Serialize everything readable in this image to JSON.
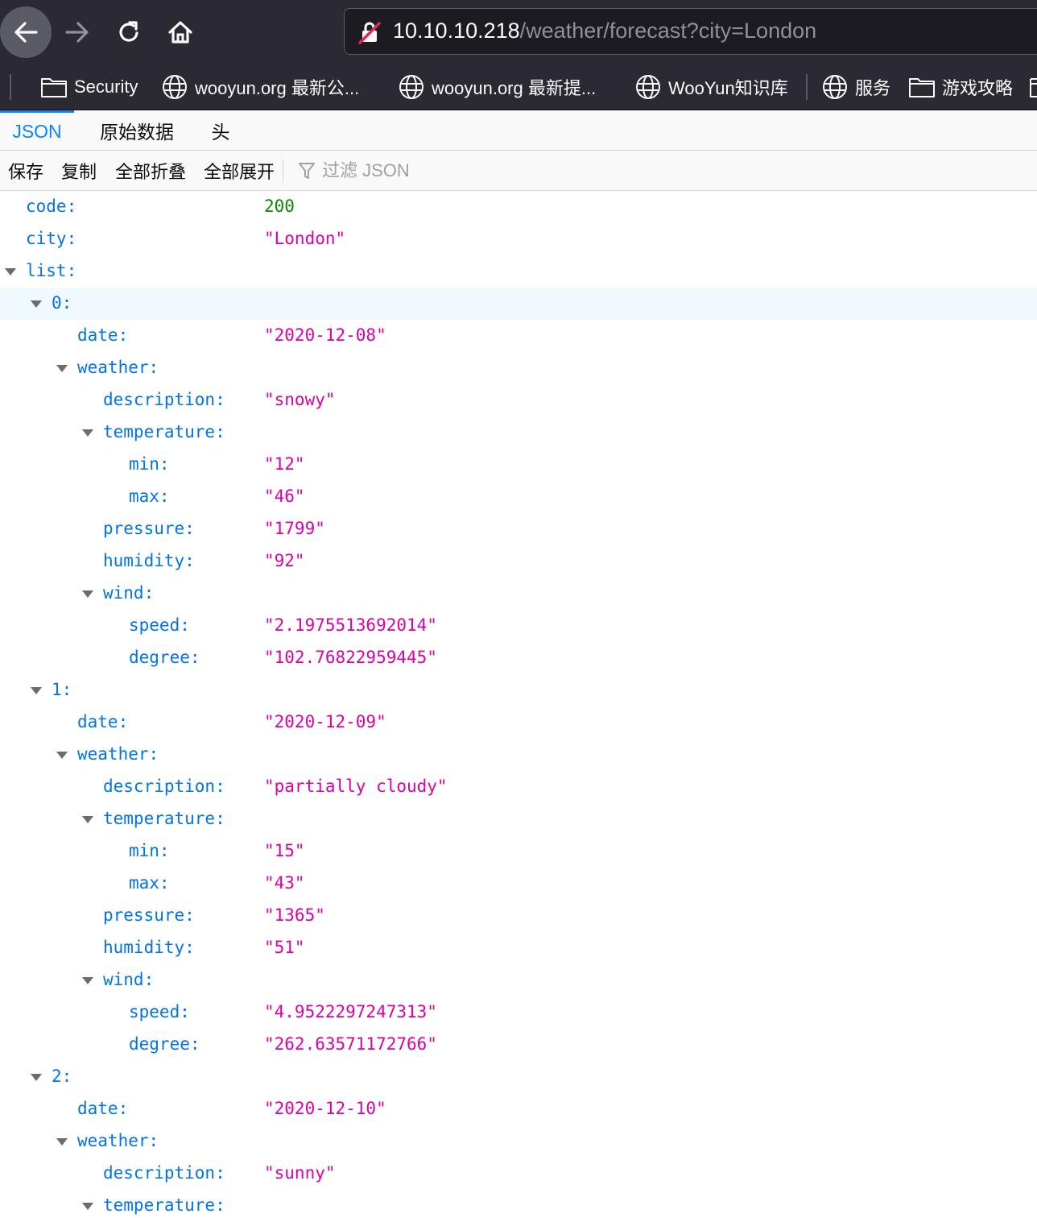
{
  "url": {
    "host": "10.10.10.218",
    "path": "/weather/forecast?city=London"
  },
  "bookmarks": [
    {
      "label": "Security",
      "icon": "folder-icon"
    },
    {
      "label": "wooyun.org 最新公...",
      "icon": "globe-icon"
    },
    {
      "label": "wooyun.org 最新提...",
      "icon": "globe-icon"
    },
    {
      "label": "WooYun知识库",
      "icon": "globe-icon"
    },
    {
      "label": "服务",
      "icon": "globe-icon"
    },
    {
      "label": "游戏攻略",
      "icon": "folder-icon"
    }
  ],
  "tabs": {
    "json": "JSON",
    "raw": "原始数据",
    "headers": "头"
  },
  "actions": {
    "save": "保存",
    "copy": "复制",
    "collapse_all": "全部折叠",
    "expand_all": "全部展开",
    "filter_placeholder": "过滤 JSON"
  },
  "tree": [
    {
      "depth": 0,
      "key": "code:",
      "value": "200",
      "type": "num"
    },
    {
      "depth": 0,
      "key": "city:",
      "value": "\"London\"",
      "type": "str"
    },
    {
      "depth": 0,
      "key": "list:",
      "expandable": true
    },
    {
      "depth": 1,
      "key": "0:",
      "expandable": true,
      "selected": true
    },
    {
      "depth": 2,
      "key": "date:",
      "value": "\"2020-12-08\"",
      "type": "str"
    },
    {
      "depth": 2,
      "key": "weather:",
      "expandable": true
    },
    {
      "depth": 3,
      "key": "description:",
      "value": "\"snowy\"",
      "type": "str"
    },
    {
      "depth": 3,
      "key": "temperature:",
      "expandable": true
    },
    {
      "depth": 4,
      "key": "min:",
      "value": "\"12\"",
      "type": "str"
    },
    {
      "depth": 4,
      "key": "max:",
      "value": "\"46\"",
      "type": "str"
    },
    {
      "depth": 3,
      "key": "pressure:",
      "value": "\"1799\"",
      "type": "str"
    },
    {
      "depth": 3,
      "key": "humidity:",
      "value": "\"92\"",
      "type": "str"
    },
    {
      "depth": 3,
      "key": "wind:",
      "expandable": true
    },
    {
      "depth": 4,
      "key": "speed:",
      "value": "\"2.1975513692014\"",
      "type": "str"
    },
    {
      "depth": 4,
      "key": "degree:",
      "value": "\"102.76822959445\"",
      "type": "str"
    },
    {
      "depth": 1,
      "key": "1:",
      "expandable": true
    },
    {
      "depth": 2,
      "key": "date:",
      "value": "\"2020-12-09\"",
      "type": "str"
    },
    {
      "depth": 2,
      "key": "weather:",
      "expandable": true
    },
    {
      "depth": 3,
      "key": "description:",
      "value": "\"partially cloudy\"",
      "type": "str"
    },
    {
      "depth": 3,
      "key": "temperature:",
      "expandable": true
    },
    {
      "depth": 4,
      "key": "min:",
      "value": "\"15\"",
      "type": "str"
    },
    {
      "depth": 4,
      "key": "max:",
      "value": "\"43\"",
      "type": "str"
    },
    {
      "depth": 3,
      "key": "pressure:",
      "value": "\"1365\"",
      "type": "str"
    },
    {
      "depth": 3,
      "key": "humidity:",
      "value": "\"51\"",
      "type": "str"
    },
    {
      "depth": 3,
      "key": "wind:",
      "expandable": true
    },
    {
      "depth": 4,
      "key": "speed:",
      "value": "\"4.9522297247313\"",
      "type": "str"
    },
    {
      "depth": 4,
      "key": "degree:",
      "value": "\"262.63571172766\"",
      "type": "str"
    },
    {
      "depth": 1,
      "key": "2:",
      "expandable": true
    },
    {
      "depth": 2,
      "key": "date:",
      "value": "\"2020-12-10\"",
      "type": "str"
    },
    {
      "depth": 2,
      "key": "weather:",
      "expandable": true
    },
    {
      "depth": 3,
      "key": "description:",
      "value": "\"sunny\"",
      "type": "str"
    },
    {
      "depth": 3,
      "key": "temperature:",
      "expandable": true
    }
  ]
}
